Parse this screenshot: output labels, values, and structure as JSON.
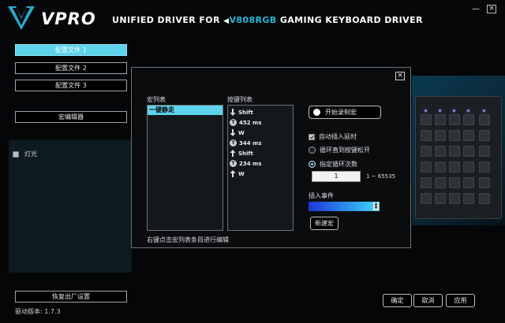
{
  "header": {
    "logo_text": "VPRO",
    "title_prefix": "UNIFIED DRIVER FOR",
    "model": "V808RGB",
    "title_suffix": "GAMING KEYBOARD DRIVER",
    "minimize_label": "—",
    "close_label": "×"
  },
  "sidebar": {
    "profiles": [
      "配置文件 1",
      "配置文件 2",
      "配置文件 3"
    ],
    "active_profile": 0,
    "macro_editor_label": "宏编辑器",
    "light_label": "灯光",
    "factory_reset_label": "恢复出厂设置",
    "version": "驱动版本: 1.7.3"
  },
  "dialog": {
    "close_label": "×",
    "macro_list_label": "宏列表",
    "macro_items": [
      "一键静走"
    ],
    "key_list_label": "按键列表",
    "key_events": [
      {
        "icon": "key-down-icon",
        "text": "Shift"
      },
      {
        "icon": "timer-icon",
        "text": "452 ms"
      },
      {
        "icon": "key-down-icon",
        "text": "W"
      },
      {
        "icon": "timer-icon",
        "text": "344 ms"
      },
      {
        "icon": "key-up-icon",
        "text": "Shift"
      },
      {
        "icon": "timer-icon",
        "text": "234 ms"
      },
      {
        "icon": "key-up-icon",
        "text": "W"
      }
    ],
    "hint": "右键点击宏列表条目进行编辑",
    "record_label": "开始录制宏",
    "auto_delay_label": "自动插入延时",
    "loop_until_release_label": "循环直到按键松开",
    "loop_count_label": "指定循环次数",
    "loop_count_value": "1",
    "loop_range": "1 ~ 65535",
    "insert_event_label": "插入事件",
    "new_macro_label": "新建宏"
  },
  "footer": {
    "ok_label": "确定",
    "cancel_label": "取消",
    "apply_label": "应用"
  },
  "colors": {
    "accent": "#5ed3ec",
    "model_text": "#29b6d9",
    "key_led": "#a277ff"
  }
}
